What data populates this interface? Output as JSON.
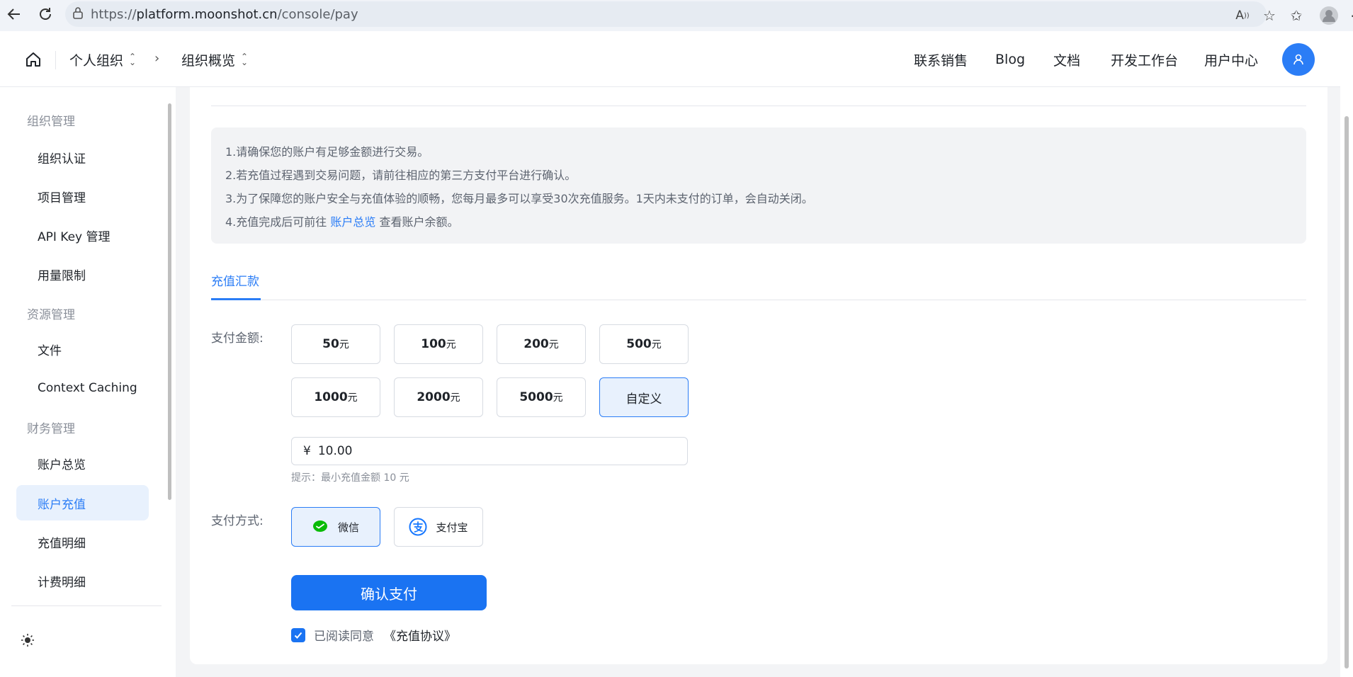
{
  "browser": {
    "url_prefix": "https://",
    "url_host": "platform.moonshot.cn",
    "url_path": "/console/pay"
  },
  "header": {
    "org_crumb": "个人组织",
    "page_crumb": "组织概览",
    "nav": [
      "联系销售",
      "Blog",
      "文档",
      "开发工作台",
      "用户中心"
    ]
  },
  "sidebar": {
    "groups": [
      "组织管理",
      "资源管理",
      "财务管理"
    ],
    "items": [
      "组织认证",
      "项目管理",
      "API Key 管理",
      "用量限制",
      "文件",
      "Context Caching",
      "账户总览",
      "账户充值",
      "充值明细",
      "计费明细"
    ],
    "active_item": "账户充值"
  },
  "notice": {
    "line1": "1.请确保您的账户有足够金额进行交易。",
    "line2": "2.若充值过程遇到交易问题，请前往相应的第三方支付平台进行确认。",
    "line3": "3.为了保障您的账户安全与充值体验的顺畅，您每月最多可以享受30次充值服务。1天内未支付的订单，会自动关闭。",
    "line4_pre": "4.充值完成后可前往",
    "line4_link": "账户总览",
    "line4_post": "查看账户余额。"
  },
  "tab": {
    "label": "充值汇款"
  },
  "amount": {
    "label": "支付金额:",
    "unit": "元",
    "options": [
      "50",
      "100",
      "200",
      "500",
      "1000",
      "2000",
      "5000"
    ],
    "custom_label": "自定义",
    "currency": "¥",
    "value": "10.00",
    "hint": "提示：最小充值金额 10 元"
  },
  "payment": {
    "label": "支付方式:",
    "wechat": "微信",
    "alipay": "支付宝"
  },
  "confirm_label": "确认支付",
  "agree": {
    "text": "已阅读同意",
    "link": "《充值协议》"
  },
  "colors": {
    "accent": "#1a73f2",
    "selected_bg": "#e8f1fd",
    "wechat": "#09bb07",
    "alipay": "#1677ff"
  }
}
